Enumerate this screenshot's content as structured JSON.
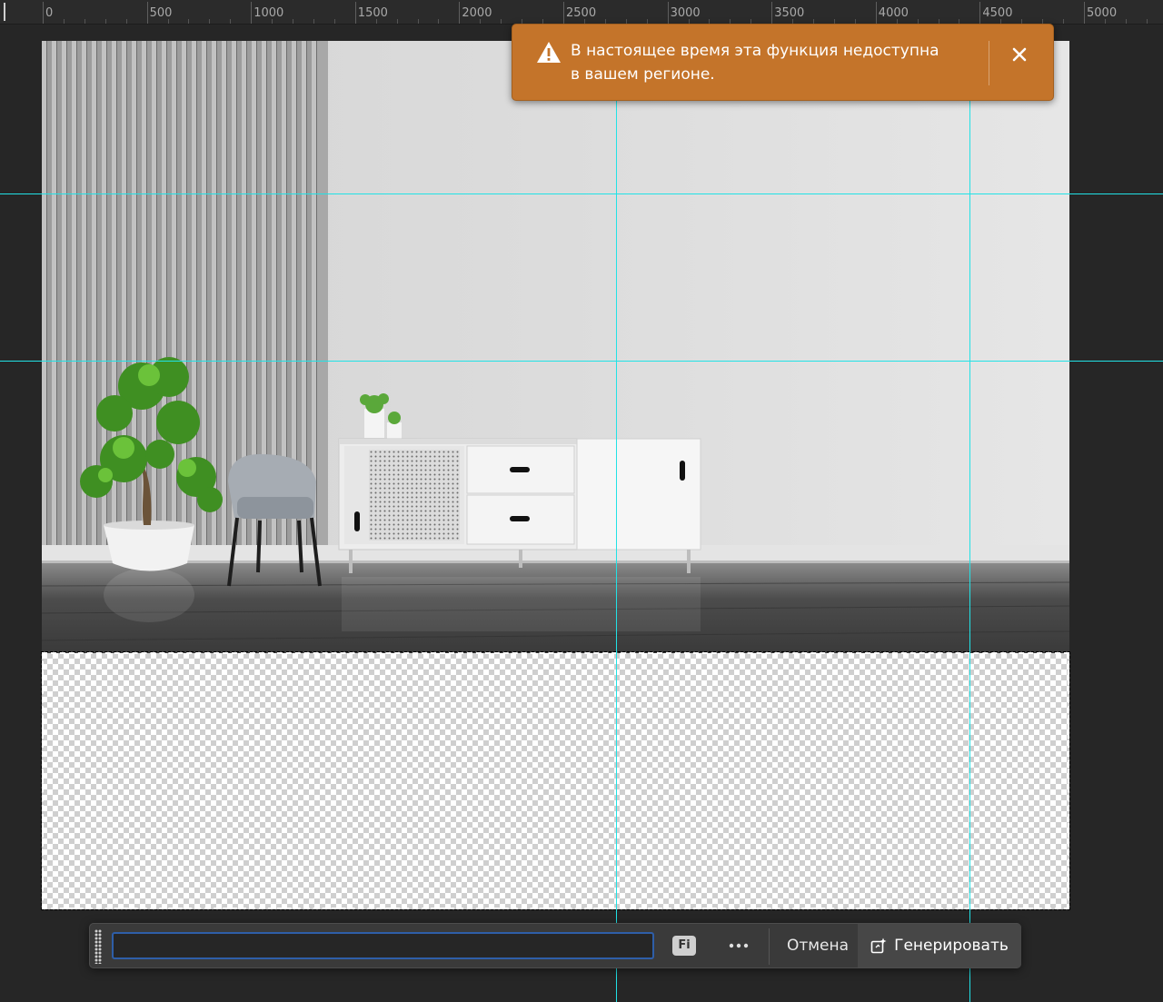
{
  "ruler": {
    "labels": [
      "0",
      "500",
      "1000",
      "1500",
      "2000",
      "2500",
      "3000",
      "3500",
      "4000",
      "4500",
      "5000"
    ]
  },
  "toast": {
    "message": "В настоящее время эта функция недоступна в вашем регионе.",
    "icon": "warning-icon",
    "close_icon": "close-icon",
    "color": "#c4742a"
  },
  "prompt_bar": {
    "input_value": "",
    "input_placeholder": "",
    "fi_label": "Fi",
    "more_icon": "ellipsis-icon",
    "cancel_label": "Отмена",
    "generate_label": "Генерировать",
    "generate_icon": "generative-sparkle-icon"
  },
  "colors": {
    "guide": "#21e2e6",
    "input_focus": "#2e5ea8",
    "workspace": "#262626"
  }
}
